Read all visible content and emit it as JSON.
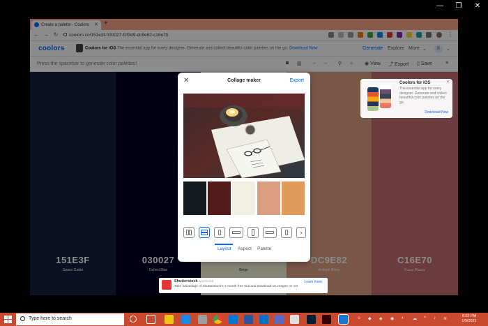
{
  "browser": {
    "tab_title": "Create a palette - Coolors",
    "url": "coolors.co/151e3f-030027-f2f3d9-dc9e82-c16e70"
  },
  "app": {
    "logo": "coolors",
    "ios_promo_title": "Coolors for iOS",
    "ios_promo_text": "The essential app for every designer. Generate and collect beautiful color palettes on the go.",
    "ios_promo_link": "Download Now",
    "nav": [
      "Generate",
      "Explore",
      "More"
    ],
    "avatar_initial": "B",
    "hint": "Press the spacebar to generate color palettes!",
    "tools": {
      "view": "View",
      "export": "Export",
      "save": "Save"
    }
  },
  "palette": [
    {
      "hex": "151E3F",
      "name": "Space Cadet",
      "color": "#151e3f",
      "text_color": "#ffffff"
    },
    {
      "hex": "030027",
      "name": "Oxford Blue",
      "color": "#030027",
      "text_color": "#ffffff"
    },
    {
      "hex": "",
      "name": "Beige",
      "color": "#f2f3d9",
      "text_color": "#333333"
    },
    {
      "hex": "DC9E82",
      "name": "Antique Brass",
      "color": "#dc9e82",
      "text_color": "#ffffff"
    },
    {
      "hex": "C16E70",
      "name": "Fuzzy Wuzzy",
      "color": "#c16e70",
      "text_color": "#ffffff"
    }
  ],
  "ios_card": {
    "title": "Coolors for iOS",
    "desc": "The essential app for every designer. Generate and collect beautiful color palettes on the go.",
    "link": "Download Now"
  },
  "modal": {
    "title": "Collage maker",
    "export": "Export",
    "swatches": [
      "#121a1d",
      "#521c1a",
      "#f2f0e2",
      "#dc9e82",
      "#e09a5a"
    ],
    "tabs": [
      "Layout",
      "Aspect",
      "Palette"
    ],
    "active_tab": "Layout"
  },
  "ad": {
    "title": "Shutterstock",
    "sponsored": "sponsored",
    "text": "Take advantage of Shutterstock's 1-month free trial and download 10 images on us!",
    "cta": "Learn more"
  },
  "taskbar": {
    "search_placeholder": "Type here to search",
    "time": "8:02 PM",
    "date": "1/9/2021"
  }
}
